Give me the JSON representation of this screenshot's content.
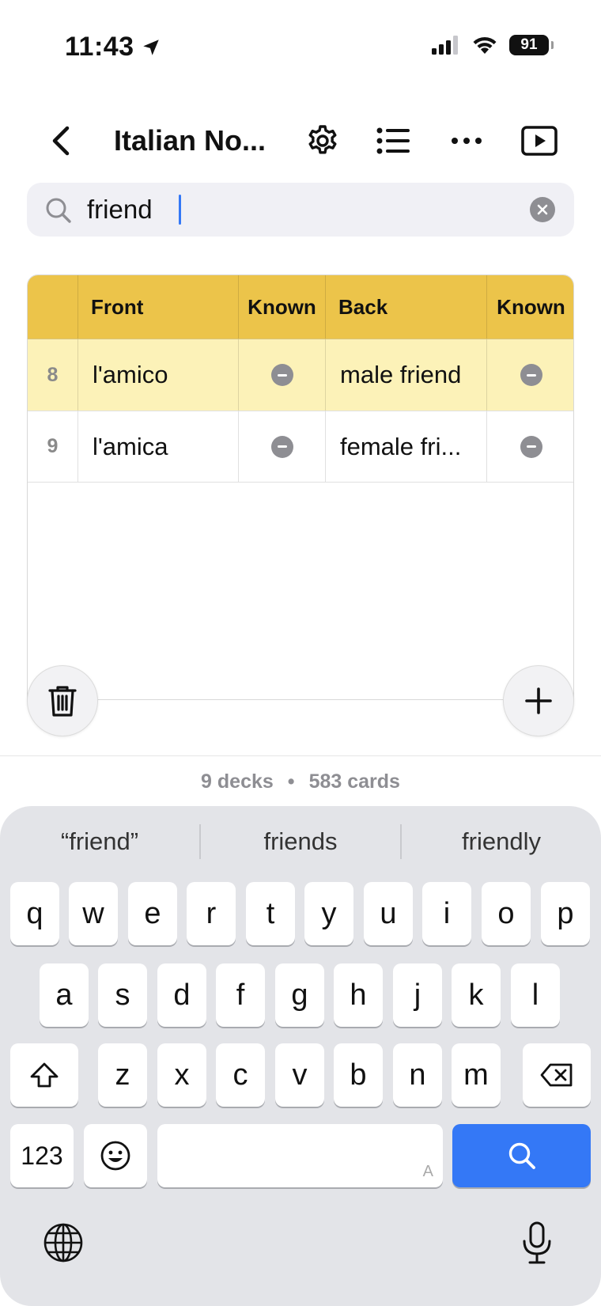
{
  "status_bar": {
    "time": "11:43",
    "battery": "91"
  },
  "nav": {
    "title": "Italian No..."
  },
  "search": {
    "value": "friend",
    "placeholder": ""
  },
  "table": {
    "columns": [
      "",
      "Front",
      "Known",
      "Back",
      "Known"
    ],
    "rows": [
      {
        "num": "8",
        "front": "l'amico",
        "back": "male friend"
      },
      {
        "num": "9",
        "front": "l'amica",
        "back": "female fri..."
      }
    ]
  },
  "summary": {
    "decks": "9 decks",
    "separator": "•",
    "cards": "583 cards"
  },
  "keyboard": {
    "suggestions": [
      "“friend”",
      "friends",
      "friendly"
    ],
    "row1": [
      "q",
      "w",
      "e",
      "r",
      "t",
      "y",
      "u",
      "i",
      "o",
      "p"
    ],
    "row2": [
      "a",
      "s",
      "d",
      "f",
      "g",
      "h",
      "j",
      "k",
      "l"
    ],
    "row3": [
      "z",
      "x",
      "c",
      "v",
      "b",
      "n",
      "m"
    ],
    "numbers_key": "123",
    "space_mark": "A"
  },
  "colors": {
    "header": "#ecc44a",
    "highlight_row": "#fcf2b8",
    "accent": "#3478f6"
  }
}
